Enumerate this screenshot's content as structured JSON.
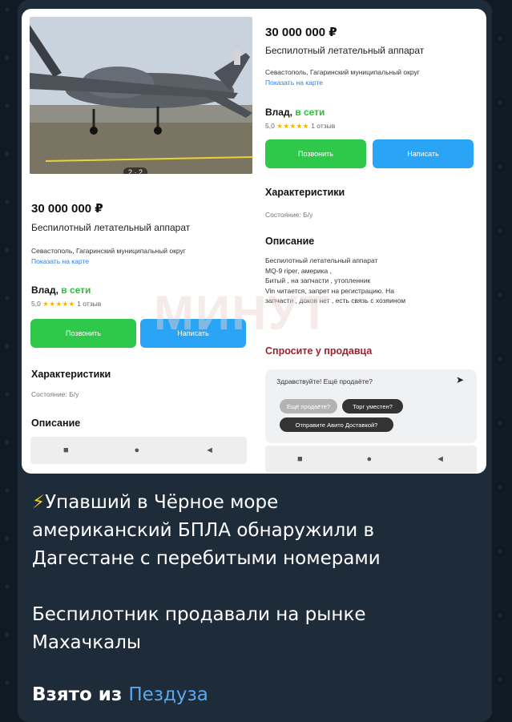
{
  "listing": {
    "price": "30 000 000 ₽",
    "title": "Беспилотный летательный аппарат",
    "address": "Севастополь, Гагаринский муниципальный округ",
    "map_link": "Показать на карте",
    "seller_name": "Влад,",
    "seller_status": "в сети",
    "rating": "5,0",
    "stars": "★★★★★",
    "reviews": "1 отзыв",
    "call_button": "Позвонить",
    "write_button": "Написать",
    "photo_counter": "2 · 2",
    "characteristics_title": "Характеристики",
    "condition": "Состояние: Б/у",
    "description_title": "Описание",
    "description_lines": [
      "Беспилотный летательный аппарат",
      "MQ-9 riper, америка ,",
      "Битый , на запчасти , утопленник",
      "Vin читается, запрет на регистрацию. На",
      "запчасти , доков нет , есть связь с хозяином"
    ],
    "ask_seller_title": "Спросите у продавца",
    "chat_prompt": "Здравствуйте! Ещё продаёте?",
    "chips": [
      "Ещё продаёте?",
      "Торг уместен?",
      "Отправите Авито Доставкой?"
    ]
  },
  "navbar": {
    "square": "■",
    "circle": "●",
    "back": "◄"
  },
  "watermark": "МИНУТ",
  "message": {
    "lightning": "⚡",
    "line1": "Упавший в Чёрное море",
    "line2": "американский БПЛА обнаружили в",
    "line3": "Дагестане с перебитыми номерами",
    "line4": "Беспилотник продавали на рынке",
    "line5": "Махачкалы",
    "source_prefix": "Взято из",
    "source_link": "Пездуза"
  },
  "colors": {
    "green": "#2ec84a",
    "blue": "#2aa4f4",
    "online": "#2fbd3c",
    "link": "#5aa8f0"
  }
}
